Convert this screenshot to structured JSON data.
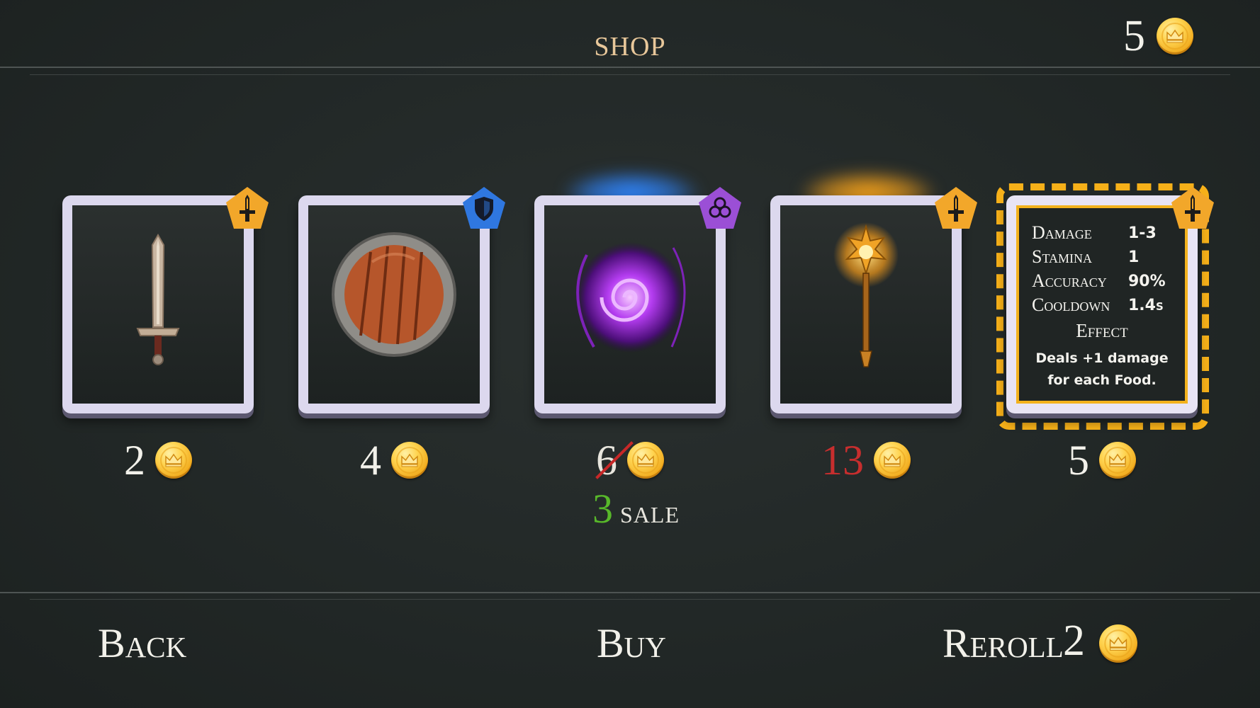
{
  "header": {
    "title": "SHOP",
    "gold": "5"
  },
  "items": [
    {
      "name": "sword",
      "class_icon": "sword-class-icon",
      "class_color": "#f2a72a",
      "price": "2"
    },
    {
      "name": "shield",
      "class_icon": "shield-class-icon",
      "class_color": "#2f77e0",
      "price": "4"
    },
    {
      "name": "vortex",
      "class_icon": "magic-class-icon",
      "class_color": "#9b4fd6",
      "original_price": "6",
      "sale_price": "3",
      "sale_label": "SALE"
    },
    {
      "name": "staff",
      "class_icon": "sword-class-icon",
      "class_color": "#f2a72a",
      "price": "13",
      "price_unaffordable": true
    },
    {
      "name": "selected-item",
      "class_icon": "sword-class-icon",
      "class_color": "#f2a72a",
      "price": "5"
    }
  ],
  "tooltip": {
    "stats": [
      {
        "label": "Damage",
        "value": "1-3"
      },
      {
        "label": "Stamina",
        "value": "1"
      },
      {
        "label": "Accuracy",
        "value": "90%"
      },
      {
        "label": "Cooldown",
        "value": "1.4s"
      }
    ],
    "effect_heading": "Effect",
    "effect_line1": "Deals +1 damage",
    "effect_line2": "for each Food."
  },
  "footer": {
    "back": "Back",
    "buy": "Buy",
    "reroll": "Reroll",
    "reroll_cost": "2"
  },
  "colors": {
    "accent_gold": "#f6b019",
    "unaffordable": "#c72e2e",
    "sale_green": "#58b82a",
    "title": "#e8c79a"
  }
}
